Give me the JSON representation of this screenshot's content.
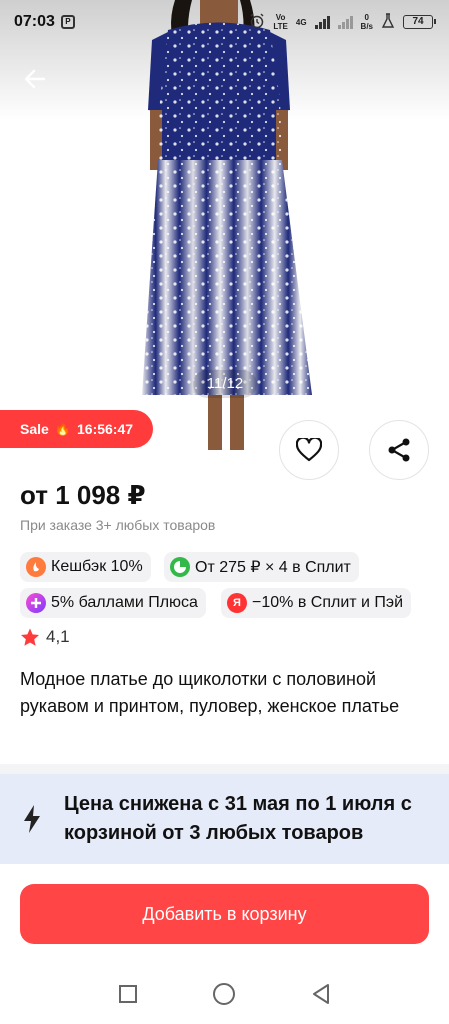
{
  "status_bar": {
    "time": "07:03",
    "app_icon_letter": "P",
    "network_top": "Vo",
    "network_bottom": "LTE",
    "signal_label": "4G",
    "speed_top": "0",
    "speed_bottom": "B/s",
    "battery": "74"
  },
  "gallery": {
    "counter": "11/12"
  },
  "sale": {
    "label": "Sale",
    "timer": "16:56:47"
  },
  "product": {
    "price": "от 1 098 ₽",
    "price_note": "При заказе 3+ любых товаров",
    "chips": [
      {
        "label": "Кешбэк 10%",
        "icon": "cashback-icon",
        "color": "#ff7a3d"
      },
      {
        "label": "От 275 ₽ × 4 в Сплит",
        "icon": "split-icon",
        "color": "#33b84a"
      },
      {
        "label": "5% баллами Плюса",
        "icon": "plus-icon",
        "color": "#c13cff"
      },
      {
        "label": "−10% в Сплит и Пэй",
        "icon": "yandex-icon",
        "color": "#ff3333",
        "icon_letter": "Я"
      }
    ],
    "rating": "4,1",
    "title": "Модное платье до щиколотки с половиной рукавом и принтом, пуловер, женское платье"
  },
  "promo": {
    "text": "Цена снижена с 31 мая по 1 июля с корзиной от 3 любых товаров"
  },
  "cta": {
    "label": "Добавить в корзину"
  },
  "colors": {
    "accent_red": "#ff4545",
    "sale_red": "#ff3b3b",
    "promo_bg": "#e6ebf9",
    "dress_blue": "#1f2a7a"
  }
}
